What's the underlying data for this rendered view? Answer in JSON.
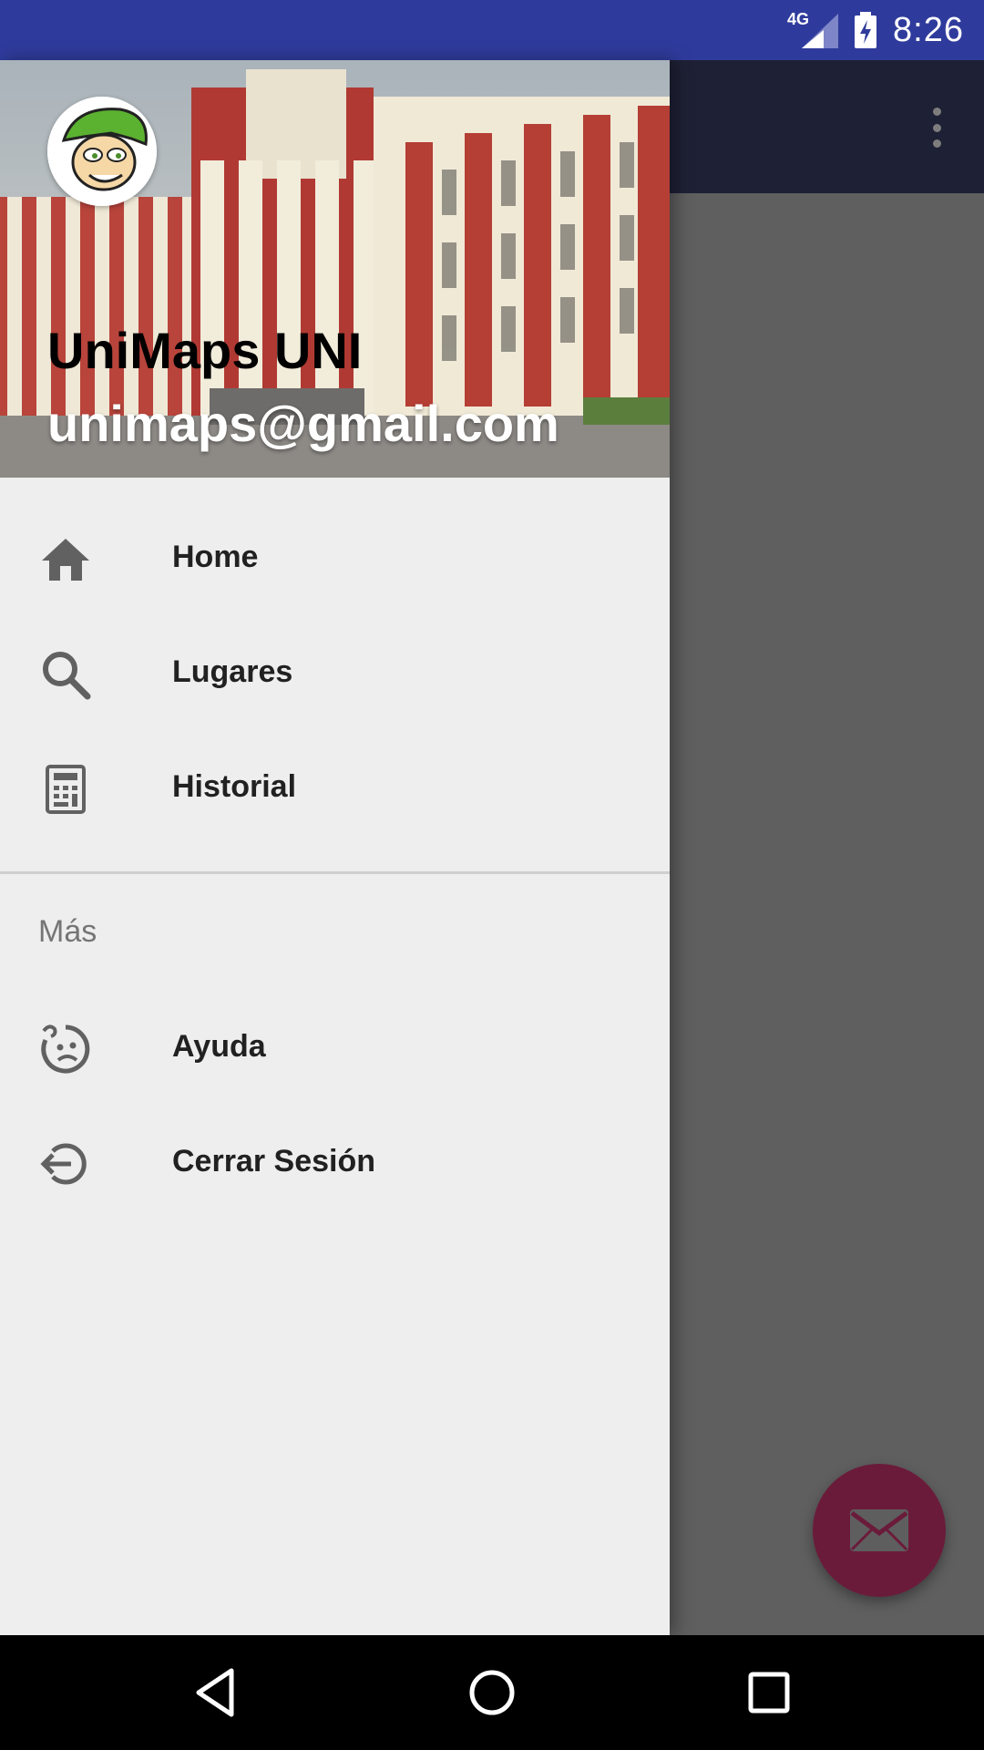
{
  "status_bar": {
    "network_label": "4G",
    "time": "8:26",
    "background": "#2f3b9c"
  },
  "app": {
    "toolbar_color": "#1e2035",
    "overflow_icon": "more-vert-icon",
    "fab_icon": "email-icon",
    "fab_color": "#6b1b3a"
  },
  "drawer": {
    "header": {
      "name": "UniMaps UNI",
      "email": "unimaps@gmail.com",
      "avatar_icon": "cartoon-avatar"
    },
    "items": [
      {
        "label": "Home",
        "icon": "home-icon"
      },
      {
        "label": "Lugares",
        "icon": "search-icon"
      },
      {
        "label": "Historial",
        "icon": "calculator-icon"
      }
    ],
    "section": {
      "title": "Más",
      "items": [
        {
          "label": "Ayuda",
          "icon": "face-help-icon"
        },
        {
          "label": "Cerrar Sesión",
          "icon": "logout-icon"
        }
      ]
    }
  },
  "nav_bar": {
    "buttons": [
      "back-icon",
      "home-circle-icon",
      "recents-icon"
    ]
  }
}
